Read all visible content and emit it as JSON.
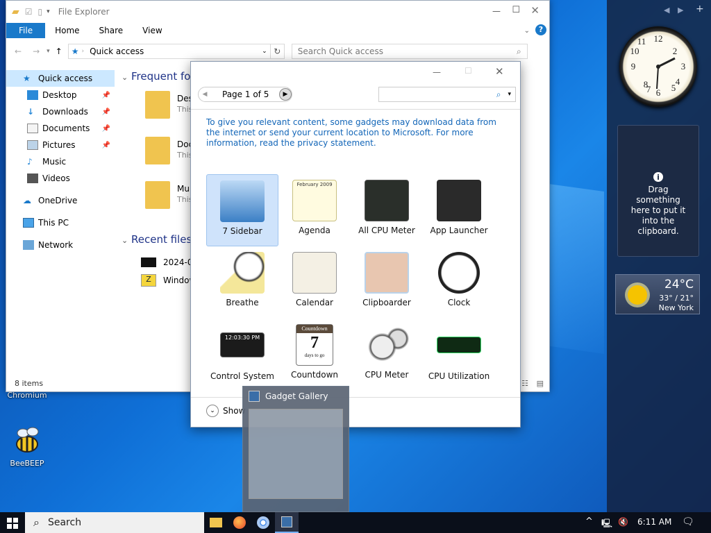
{
  "explorer": {
    "title": "File Explorer",
    "ribbon": {
      "file": "File",
      "home": "Home",
      "share": "Share",
      "view": "View"
    },
    "address": "Quick access",
    "search_placeholder": "Search Quick access",
    "nav": [
      {
        "label": "Quick access",
        "icon": "star-icon"
      },
      {
        "label": "Desktop",
        "icon": "desktop-icon"
      },
      {
        "label": "Downloads",
        "icon": "download-icon"
      },
      {
        "label": "Documents",
        "icon": "documents-icon"
      },
      {
        "label": "Pictures",
        "icon": "pictures-icon"
      },
      {
        "label": "Music",
        "icon": "music-icon"
      },
      {
        "label": "Videos",
        "icon": "videos-icon"
      },
      {
        "label": "OneDrive",
        "icon": "cloud-icon"
      },
      {
        "label": "This PC",
        "icon": "pc-icon"
      },
      {
        "label": "Network",
        "icon": "network-icon"
      }
    ],
    "sections": {
      "frequent": "Frequent fold",
      "recent": "Recent files ("
    },
    "frequent_items": [
      {
        "name": "Des",
        "sub": "This"
      },
      {
        "name": "Doc",
        "sub": "This"
      },
      {
        "name": "Mu",
        "sub": "This"
      }
    ],
    "recent_items": [
      {
        "name": "2024-06"
      },
      {
        "name": "Window"
      }
    ],
    "status": "8 items"
  },
  "gallery": {
    "page": "Page 1 of 5",
    "notice": "To give you relevant content, some gadgets may download data from the internet or send your current location to Microsoft. For more information, read the privacy statement.",
    "tiles": [
      "7 Sidebar",
      "Agenda",
      "All CPU Meter",
      "App Launcher",
      "Breathe",
      "Calendar",
      "Clipboarder",
      "Clock",
      "Control System",
      "Countdown",
      "CPU Meter",
      "CPU Utilization"
    ],
    "show": "Show",
    "countdown": {
      "head": "Countdown",
      "num": "7",
      "sub": "days to go"
    },
    "control_time": "12:03:30 PM",
    "agenda_head": "February 2009"
  },
  "preview": {
    "title": "Gadget Gallery"
  },
  "desktop": {
    "chromium": "Chromium",
    "beebeep": "BeeBEEP"
  },
  "sidebar": {
    "clipboard": "Drag something here to put it into the clipboard.",
    "weather": {
      "temp": "24°C",
      "range": "33° / 21°",
      "city": "New York"
    }
  },
  "taskbar": {
    "search": "Search",
    "time": "6:11 AM"
  },
  "colors": {
    "accent": "#1979ca",
    "desktop": "#0f6fd6",
    "taskbar": "#0a0f1a"
  }
}
